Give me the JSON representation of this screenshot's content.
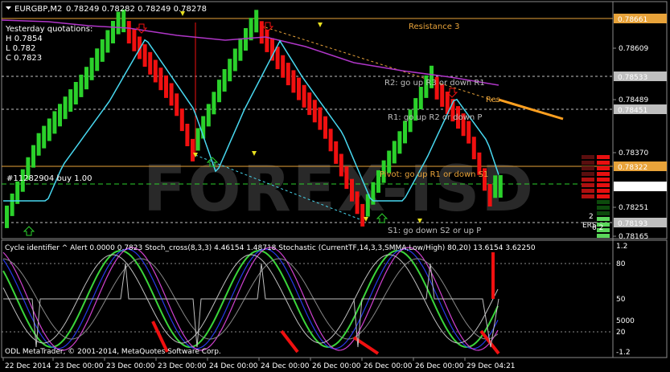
{
  "header": {
    "symbol": "EURGBP,M2",
    "quotes": "0.78249 0.78282 0.78249 0.78278"
  },
  "yesterday": {
    "title": "Yesterday quotations:",
    "high": "H 0.7854",
    "low": "L 0.782",
    "close": "C 0.7823"
  },
  "levels": {
    "resistance3": "Resistance 3",
    "r2": "R2: go up R3 or down R1",
    "r1": "R1: go up R2 or down P",
    "pivot": "Pivot: go up R1 or down S1",
    "s1": "S1: go down S2 or up P",
    "order": "#11282904 buy 1.00",
    "res_tag": "Res"
  },
  "price_axis": {
    "ticks": [
      "0.78609",
      "0.78489",
      "0.78370",
      "0.78251",
      "0.78165"
    ],
    "tags": [
      {
        "label": "0.78661",
        "color": "#e8a33a",
        "text_color": "#000000"
      },
      {
        "label": "0.78533",
        "color": "#bfbfbf",
        "text_color": "#000000"
      },
      {
        "label": "0.78451",
        "color": "#bfbfbf",
        "text_color": "#000000"
      },
      {
        "label": "0.78322",
        "color": "#e8a33a",
        "text_color": "#000000"
      },
      {
        "label": "0.78278",
        "color": "#ffffff",
        "text_color": "#000000"
      },
      {
        "label": "0.78193",
        "color": "#bfbfbf",
        "text_color": "#000000"
      }
    ]
  },
  "subwindow": {
    "title": "Cycle identifier ^ Alert 0.0000 0.7823  Stoch_cross(8,3,3) 4.46154 1.48718  Stochastic (CurrentTF,14,3,3,SMMA,Low/High) 80,20) 13.6154 3.62250",
    "ticks": [
      "1.2",
      "80",
      "50",
      "5000",
      "20",
      "-1.2"
    ]
  },
  "time_axis": [
    "22 Dec 2014",
    "23 Dec 00:00",
    "23 Dec 00:00",
    "23 Dec 00:00",
    "24 Dec 00:00",
    "24 Dec 00:00",
    "26 Dec 00:00",
    "26 Dec 00:00",
    "26 Dec 00:00",
    "29 Dec 04:21"
  ],
  "copyright": "ODL MetaTrader, © 2001-2014, MetaQuotes Software Corp.",
  "watermark": "FOREX-ISD",
  "panel": {
    "label_a": "2",
    "label_b": "ERS",
    "label_c": "6   2"
  },
  "colors": {
    "bull": "#2bd12b",
    "bear": "#f01010",
    "ma_cyan": "#48d8f0",
    "ma_purple": "#b036c8",
    "resistance": "#e8a33a",
    "level_gray": "#bfbfbf"
  }
}
